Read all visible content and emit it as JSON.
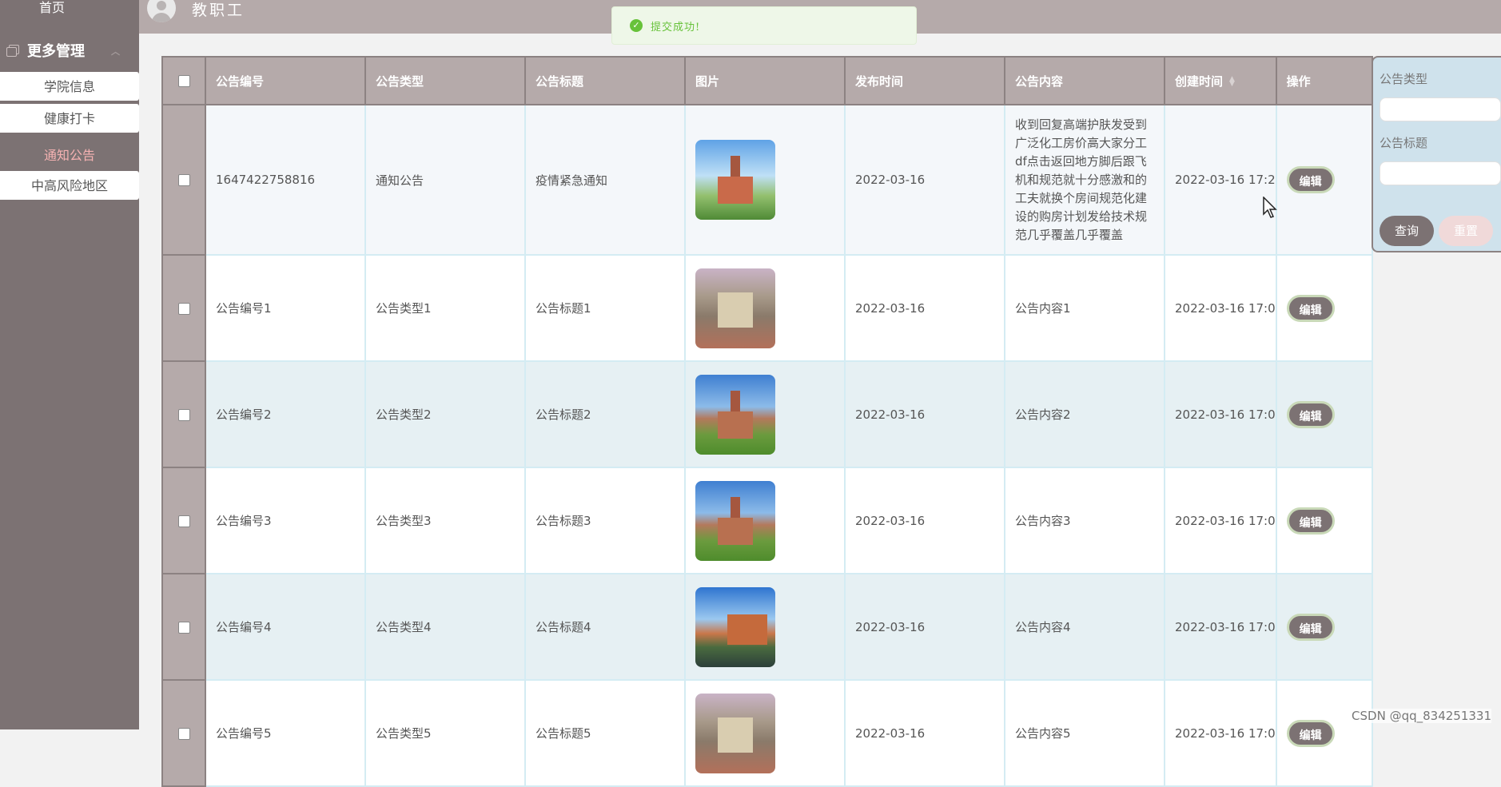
{
  "sidebar": {
    "home": "首页",
    "group_label": "更多管理",
    "items": [
      {
        "label": "学院信息",
        "active": false
      },
      {
        "label": "健康打卡",
        "active": false
      },
      {
        "label": "通知公告",
        "active": true
      },
      {
        "label": "中高风险地区",
        "active": false
      }
    ]
  },
  "header": {
    "username": "教职工"
  },
  "toast": {
    "text": "提交成功!",
    "icon": "check-circle-icon",
    "color": "#67c23a"
  },
  "table": {
    "columns": [
      "公告编号",
      "公告类型",
      "公告标题",
      "图片",
      "发布时间",
      "公告内容",
      "创建时间",
      "操作"
    ],
    "edit_label": "编辑",
    "rows": [
      {
        "id": "1647422758816",
        "type": "通知公告",
        "title": "疫情紧急通知",
        "publish_time": "2022-03-16",
        "content": "收到回复高端护肤发受到广泛化工房价高大家分工df点击返回地方脚后跟飞机和规范就十分感激和的工夫就换个房间规范化建设的购房计划发给技术规范几乎覆盖几乎覆盖",
        "created_time": "2022-03-16 17:2"
      },
      {
        "id": "公告编号1",
        "type": "公告类型1",
        "title": "公告标题1",
        "publish_time": "2022-03-16",
        "content": "公告内容1",
        "created_time": "2022-03-16 17:0"
      },
      {
        "id": "公告编号2",
        "type": "公告类型2",
        "title": "公告标题2",
        "publish_time": "2022-03-16",
        "content": "公告内容2",
        "created_time": "2022-03-16 17:0"
      },
      {
        "id": "公告编号3",
        "type": "公告类型3",
        "title": "公告标题3",
        "publish_time": "2022-03-16",
        "content": "公告内容3",
        "created_time": "2022-03-16 17:0"
      },
      {
        "id": "公告编号4",
        "type": "公告类型4",
        "title": "公告标题4",
        "publish_time": "2022-03-16",
        "content": "公告内容4",
        "created_time": "2022-03-16 17:0"
      },
      {
        "id": "公告编号5",
        "type": "公告类型5",
        "title": "公告标题5",
        "publish_time": "2022-03-16",
        "content": "公告内容5",
        "created_time": "2022-03-16 17:0"
      }
    ]
  },
  "search": {
    "type_label": "公告类型",
    "title_label": "公告标题",
    "query_label": "查询",
    "reset_label": "重置"
  },
  "watermark": "CSDN @qq_834251331",
  "colors": {
    "sidebar_bg": "#7c7273",
    "header_bg": "#b5aaaa",
    "active_item": "#f5b2b2",
    "panel_bg": "#cfe2ec"
  }
}
